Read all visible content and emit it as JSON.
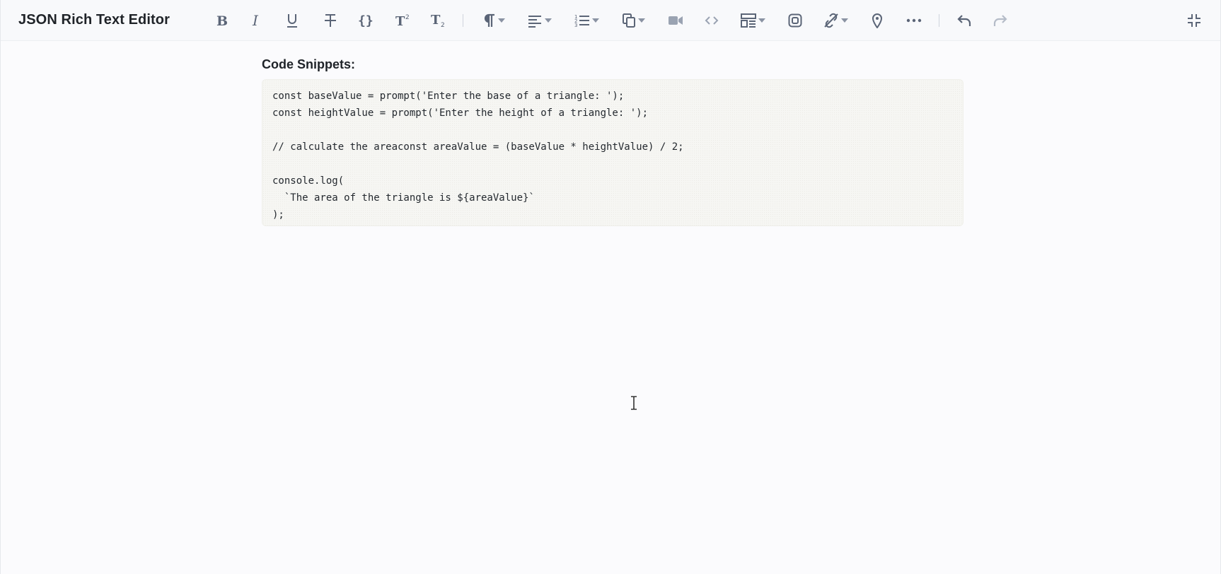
{
  "app": {
    "title": "JSON Rich Text Editor"
  },
  "toolbar": {
    "buttons": [
      {
        "name": "bold",
        "icon": "bold-icon"
      },
      {
        "name": "italic",
        "icon": "italic-icon"
      },
      {
        "name": "underline",
        "icon": "underline-icon"
      },
      {
        "name": "strikethrough",
        "icon": "strikethrough-icon"
      },
      {
        "name": "inline-code",
        "icon": "curly-braces-icon"
      },
      {
        "name": "superscript",
        "icon": "superscript-icon"
      },
      {
        "name": "subscript",
        "icon": "subscript-icon"
      },
      {
        "name": "paragraph",
        "icon": "pilcrow-icon",
        "dropdown": true
      },
      {
        "name": "align",
        "icon": "align-left-icon",
        "dropdown": true
      },
      {
        "name": "list",
        "icon": "numbered-list-icon",
        "dropdown": true
      },
      {
        "name": "copy",
        "icon": "copy-icon",
        "dropdown": true
      },
      {
        "name": "video",
        "icon": "video-icon"
      },
      {
        "name": "embed",
        "icon": "code-brackets-icon"
      },
      {
        "name": "table",
        "icon": "table-icon",
        "dropdown": true
      },
      {
        "name": "instagram",
        "icon": "instagram-icon"
      },
      {
        "name": "link",
        "icon": "link-off-icon",
        "dropdown": true
      },
      {
        "name": "location",
        "icon": "map-pin-icon"
      },
      {
        "name": "more",
        "icon": "more-horizontal-icon"
      },
      {
        "name": "undo",
        "icon": "undo-icon"
      },
      {
        "name": "redo",
        "icon": "redo-icon",
        "disabled": true
      },
      {
        "name": "collapse",
        "icon": "minimize-icon"
      }
    ]
  },
  "editor": {
    "heading": "Code Snippets:",
    "code_lines": [
      "const baseValue = prompt('Enter the base of a triangle: ');",
      "const heightValue = prompt('Enter the height of a triangle: ');",
      "",
      "// calculate the areaconst areaValue = (baseValue * heightValue) / 2;",
      "",
      "console.log(",
      "  `The area of the triangle is ${areaValue}`",
      ");"
    ]
  },
  "colors": {
    "icon": "#5b6577",
    "icon_disabled": "#b5bcc8",
    "background": "#fbfbfd",
    "code_background": "#f6f6f3"
  }
}
